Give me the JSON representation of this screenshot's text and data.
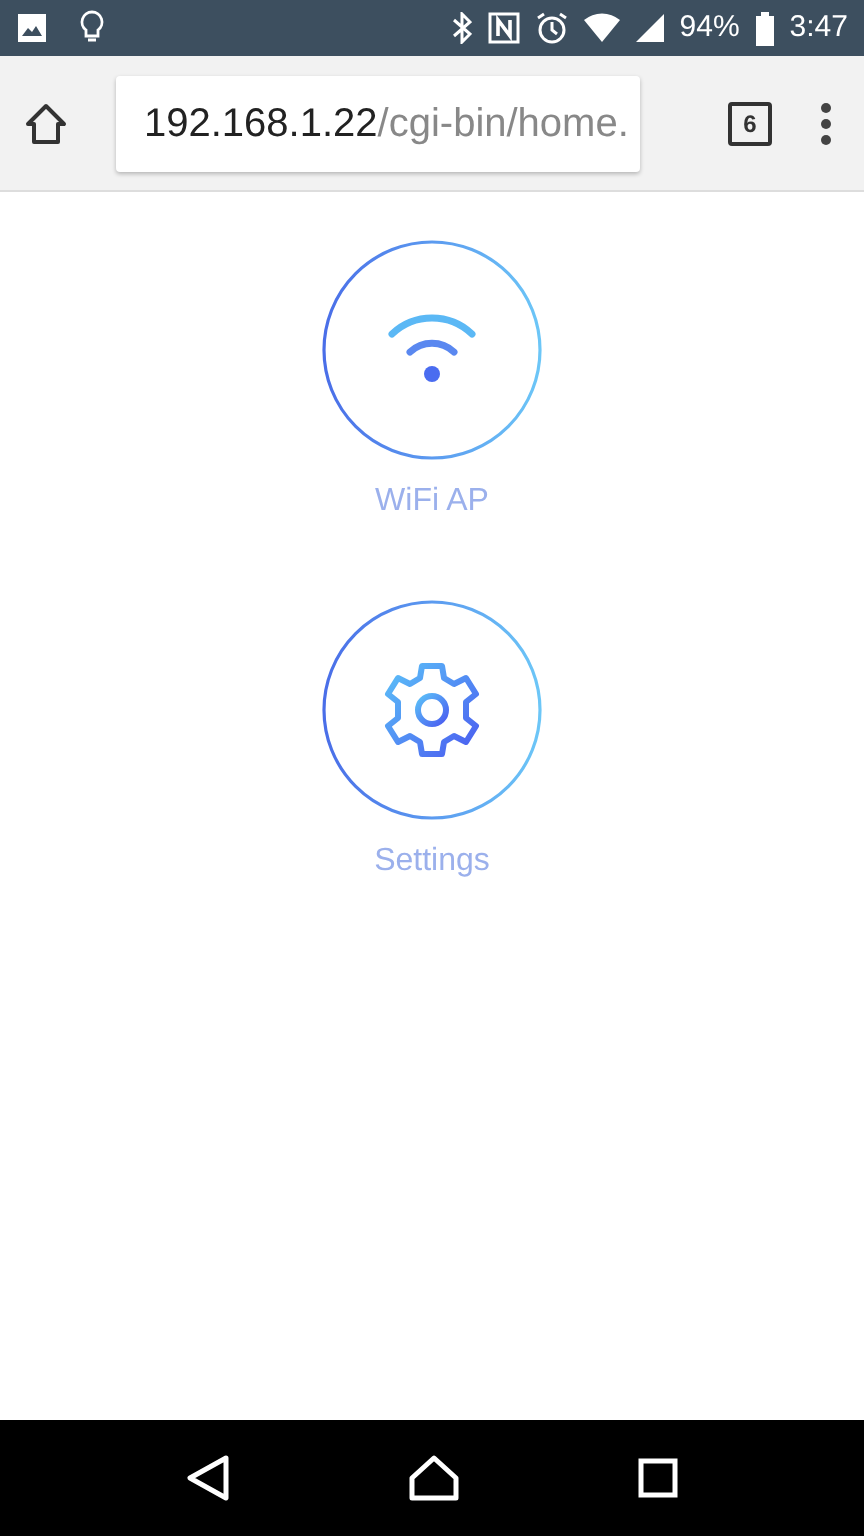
{
  "status_bar": {
    "battery": "94%",
    "time": "3:47"
  },
  "browser": {
    "url_host": "192.168.1.22",
    "url_path": "/cgi-bin/home.",
    "tab_count": "6"
  },
  "tiles": [
    {
      "kind": "wifi",
      "label": "WiFi AP"
    },
    {
      "kind": "settings",
      "label": "Settings"
    }
  ]
}
